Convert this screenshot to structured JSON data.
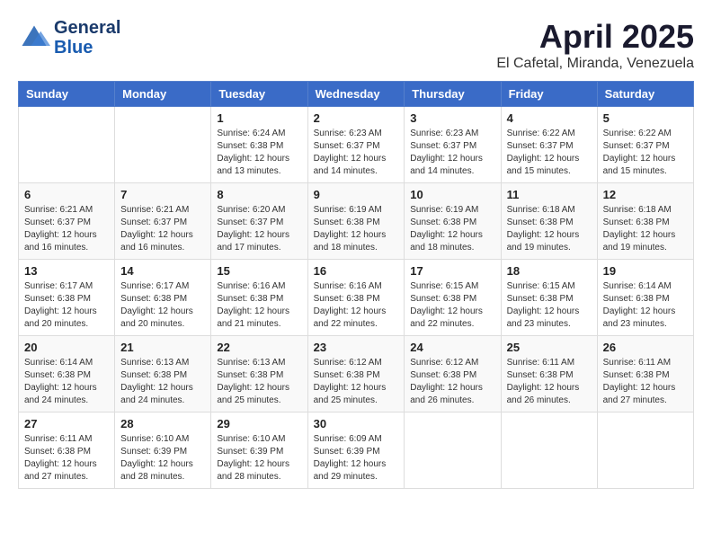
{
  "header": {
    "logo_line1": "General",
    "logo_line2": "Blue",
    "title": "April 2025",
    "subtitle": "El Cafetal, Miranda, Venezuela"
  },
  "days_of_week": [
    "Sunday",
    "Monday",
    "Tuesday",
    "Wednesday",
    "Thursday",
    "Friday",
    "Saturday"
  ],
  "weeks": [
    [
      {
        "day": "",
        "info": ""
      },
      {
        "day": "",
        "info": ""
      },
      {
        "day": "1",
        "info": "Sunrise: 6:24 AM\nSunset: 6:38 PM\nDaylight: 12 hours\nand 13 minutes."
      },
      {
        "day": "2",
        "info": "Sunrise: 6:23 AM\nSunset: 6:37 PM\nDaylight: 12 hours\nand 14 minutes."
      },
      {
        "day": "3",
        "info": "Sunrise: 6:23 AM\nSunset: 6:37 PM\nDaylight: 12 hours\nand 14 minutes."
      },
      {
        "day": "4",
        "info": "Sunrise: 6:22 AM\nSunset: 6:37 PM\nDaylight: 12 hours\nand 15 minutes."
      },
      {
        "day": "5",
        "info": "Sunrise: 6:22 AM\nSunset: 6:37 PM\nDaylight: 12 hours\nand 15 minutes."
      }
    ],
    [
      {
        "day": "6",
        "info": "Sunrise: 6:21 AM\nSunset: 6:37 PM\nDaylight: 12 hours\nand 16 minutes."
      },
      {
        "day": "7",
        "info": "Sunrise: 6:21 AM\nSunset: 6:37 PM\nDaylight: 12 hours\nand 16 minutes."
      },
      {
        "day": "8",
        "info": "Sunrise: 6:20 AM\nSunset: 6:37 PM\nDaylight: 12 hours\nand 17 minutes."
      },
      {
        "day": "9",
        "info": "Sunrise: 6:19 AM\nSunset: 6:38 PM\nDaylight: 12 hours\nand 18 minutes."
      },
      {
        "day": "10",
        "info": "Sunrise: 6:19 AM\nSunset: 6:38 PM\nDaylight: 12 hours\nand 18 minutes."
      },
      {
        "day": "11",
        "info": "Sunrise: 6:18 AM\nSunset: 6:38 PM\nDaylight: 12 hours\nand 19 minutes."
      },
      {
        "day": "12",
        "info": "Sunrise: 6:18 AM\nSunset: 6:38 PM\nDaylight: 12 hours\nand 19 minutes."
      }
    ],
    [
      {
        "day": "13",
        "info": "Sunrise: 6:17 AM\nSunset: 6:38 PM\nDaylight: 12 hours\nand 20 minutes."
      },
      {
        "day": "14",
        "info": "Sunrise: 6:17 AM\nSunset: 6:38 PM\nDaylight: 12 hours\nand 20 minutes."
      },
      {
        "day": "15",
        "info": "Sunrise: 6:16 AM\nSunset: 6:38 PM\nDaylight: 12 hours\nand 21 minutes."
      },
      {
        "day": "16",
        "info": "Sunrise: 6:16 AM\nSunset: 6:38 PM\nDaylight: 12 hours\nand 22 minutes."
      },
      {
        "day": "17",
        "info": "Sunrise: 6:15 AM\nSunset: 6:38 PM\nDaylight: 12 hours\nand 22 minutes."
      },
      {
        "day": "18",
        "info": "Sunrise: 6:15 AM\nSunset: 6:38 PM\nDaylight: 12 hours\nand 23 minutes."
      },
      {
        "day": "19",
        "info": "Sunrise: 6:14 AM\nSunset: 6:38 PM\nDaylight: 12 hours\nand 23 minutes."
      }
    ],
    [
      {
        "day": "20",
        "info": "Sunrise: 6:14 AM\nSunset: 6:38 PM\nDaylight: 12 hours\nand 24 minutes."
      },
      {
        "day": "21",
        "info": "Sunrise: 6:13 AM\nSunset: 6:38 PM\nDaylight: 12 hours\nand 24 minutes."
      },
      {
        "day": "22",
        "info": "Sunrise: 6:13 AM\nSunset: 6:38 PM\nDaylight: 12 hours\nand 25 minutes."
      },
      {
        "day": "23",
        "info": "Sunrise: 6:12 AM\nSunset: 6:38 PM\nDaylight: 12 hours\nand 25 minutes."
      },
      {
        "day": "24",
        "info": "Sunrise: 6:12 AM\nSunset: 6:38 PM\nDaylight: 12 hours\nand 26 minutes."
      },
      {
        "day": "25",
        "info": "Sunrise: 6:11 AM\nSunset: 6:38 PM\nDaylight: 12 hours\nand 26 minutes."
      },
      {
        "day": "26",
        "info": "Sunrise: 6:11 AM\nSunset: 6:38 PM\nDaylight: 12 hours\nand 27 minutes."
      }
    ],
    [
      {
        "day": "27",
        "info": "Sunrise: 6:11 AM\nSunset: 6:38 PM\nDaylight: 12 hours\nand 27 minutes."
      },
      {
        "day": "28",
        "info": "Sunrise: 6:10 AM\nSunset: 6:39 PM\nDaylight: 12 hours\nand 28 minutes."
      },
      {
        "day": "29",
        "info": "Sunrise: 6:10 AM\nSunset: 6:39 PM\nDaylight: 12 hours\nand 28 minutes."
      },
      {
        "day": "30",
        "info": "Sunrise: 6:09 AM\nSunset: 6:39 PM\nDaylight: 12 hours\nand 29 minutes."
      },
      {
        "day": "",
        "info": ""
      },
      {
        "day": "",
        "info": ""
      },
      {
        "day": "",
        "info": ""
      }
    ]
  ]
}
